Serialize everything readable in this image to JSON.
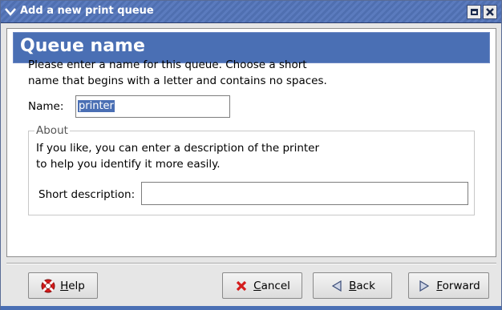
{
  "window": {
    "title": "Add a new print queue"
  },
  "banner": {
    "title": "Queue name"
  },
  "form": {
    "intro_line1": "Please enter a name for this queue.  Choose a short",
    "intro_line2": "name that begins with a letter and contains no spaces.",
    "name_label": "Name:",
    "name_value": "printer",
    "about_legend": "About",
    "about_line1": "If you like, you can enter a description of the printer",
    "about_line2": "to help you identify it more easily.",
    "desc_label": "Short description:",
    "desc_value": ""
  },
  "buttons": {
    "help": {
      "mnemonic": "H",
      "rest": "elp"
    },
    "cancel": {
      "mnemonic": "C",
      "rest": "ancel"
    },
    "back": {
      "mnemonic": "B",
      "rest": "ack"
    },
    "forward": {
      "mnemonic": "F",
      "rest": "orward"
    }
  },
  "icons": {
    "window_menu": "chevron-down-icon",
    "maximize": "maximize-icon",
    "close": "close-icon",
    "help": "lifebuoy-icon",
    "cancel": "x-icon",
    "back": "arrow-left-icon",
    "forward": "arrow-right-icon"
  },
  "colors": {
    "accent": "#4a6fb4",
    "cancel_red": "#d41c1c"
  }
}
